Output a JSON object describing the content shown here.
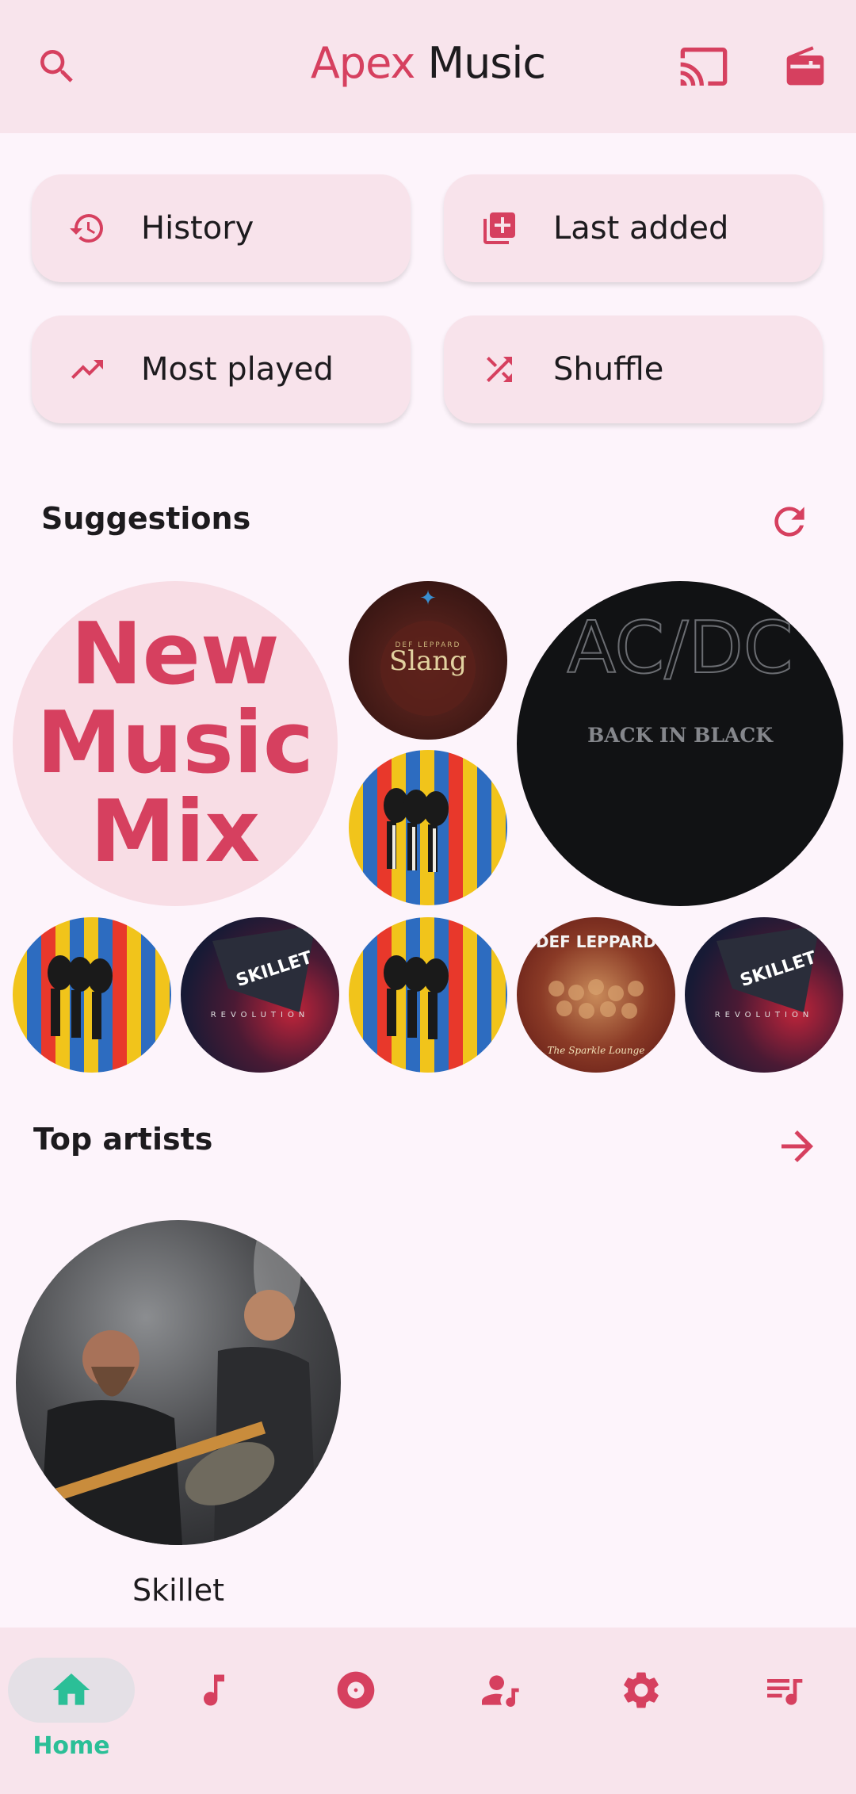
{
  "appbar": {
    "title_accent": "Apex",
    "title_rest": "Music",
    "icons": [
      "search-icon",
      "cast-icon",
      "radio-icon"
    ]
  },
  "quick_actions": [
    {
      "label": "History",
      "icon": "history-icon"
    },
    {
      "label": "Last added",
      "icon": "library-add-icon"
    },
    {
      "label": "Most played",
      "icon": "trending-up-icon"
    },
    {
      "label": "Shuffle",
      "icon": "shuffle-icon"
    }
  ],
  "suggestions": {
    "title": "Suggestions",
    "refresh_icon": "refresh-icon",
    "mix_lines": [
      "New",
      "Music",
      "Mix"
    ],
    "albums": {
      "slang_text": "Slang",
      "slang_band": "DEF LEPPARD",
      "acdc_logo": "AC/DC",
      "acdc_subtitle": "BACK IN BLACK",
      "skillet_text": "SKILLET",
      "skillet_subtitle": "REVOLUTION",
      "sparkle_text": "The Sparkle Lounge",
      "sparkle_band": "DEF LEPPARD"
    }
  },
  "top_artists": {
    "title": "Top artists",
    "arrow_icon": "arrow-forward-icon",
    "artists": [
      {
        "name": "Skillet"
      }
    ]
  },
  "bottom_nav": {
    "items": [
      {
        "label": "Home",
        "icon": "home-icon",
        "active": true
      },
      {
        "label": "",
        "icon": "music-note-icon"
      },
      {
        "label": "",
        "icon": "album-icon"
      },
      {
        "label": "",
        "icon": "artist-icon"
      },
      {
        "label": "",
        "icon": "settings-icon"
      },
      {
        "label": "",
        "icon": "playlist-icon"
      }
    ]
  },
  "colors": {
    "accent": "#d6405f",
    "active_nav": "#2bbf97",
    "appbar_bg": "#f8e4ec",
    "page_bg": "#fdf4fb"
  }
}
